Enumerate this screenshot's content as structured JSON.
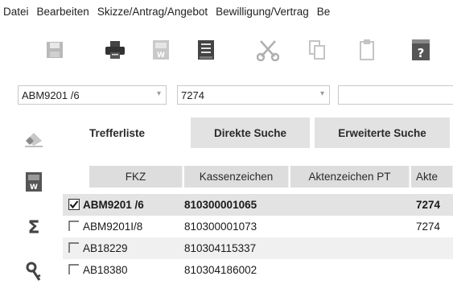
{
  "menubar": {
    "items": [
      "Datei",
      "Bearbeiten",
      "Skizze/Antrag/Angebot",
      "Bewilligung/Vertrag",
      "Be"
    ]
  },
  "toolbar": {
    "buttons": [
      {
        "icon": "save-icon"
      },
      {
        "icon": "print-icon"
      },
      {
        "icon": "web-export-icon"
      },
      {
        "icon": "form-icon"
      },
      {
        "icon": "cut-icon"
      },
      {
        "icon": "copy-icon"
      },
      {
        "icon": "paste-icon"
      },
      {
        "icon": "help-icon"
      }
    ]
  },
  "filters": {
    "fkz_value": "ABM9201 /6",
    "kasse_value": "7274",
    "third_value": ""
  },
  "sidebar": {
    "icons": [
      "eraser-icon",
      "web-document-icon",
      "sigma-icon",
      "key-icon"
    ]
  },
  "tabs": [
    {
      "label": "Trefferliste",
      "active": true
    },
    {
      "label": "Direkte Suche",
      "active": false
    },
    {
      "label": "Erweiterte Suche",
      "active": false
    }
  ],
  "table": {
    "columns": [
      "FKZ",
      "Kassenzeichen",
      "Aktenzeichen PT",
      "Akte"
    ],
    "rows": [
      {
        "checked": true,
        "fkz": "ABM9201 /6",
        "kassenzeichen": "810300001065",
        "aktenzeichen": "",
        "akte": "7274"
      },
      {
        "checked": false,
        "fkz": "ABM9201I/8",
        "kassenzeichen": "810300001073",
        "aktenzeichen": "",
        "akte": "7274"
      },
      {
        "checked": false,
        "fkz": "AB18229",
        "kassenzeichen": "810304115337",
        "aktenzeichen": "",
        "akte": ""
      },
      {
        "checked": false,
        "fkz": "AB18380",
        "kassenzeichen": "810304186002",
        "aktenzeichen": "",
        "akte": ""
      }
    ]
  },
  "colors": {
    "tab_inactive": "#e2e2e2",
    "header_bg": "#dddddd",
    "row_alt": "#f0f0f0",
    "row_selected": "#e3e3e3"
  }
}
